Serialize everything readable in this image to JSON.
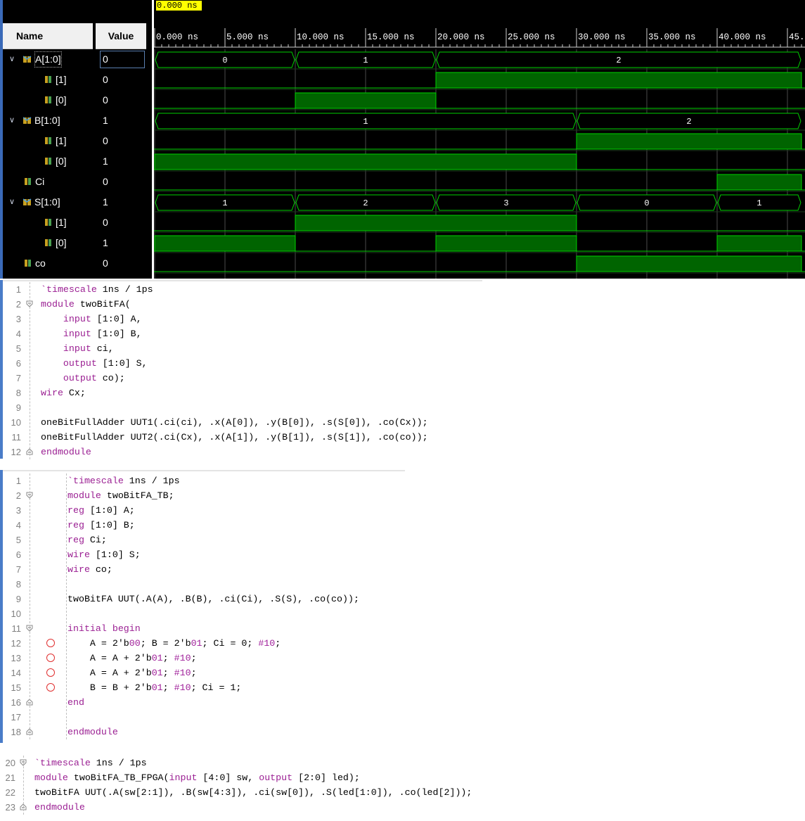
{
  "waveform": {
    "cursor_time": "0.000 ns",
    "columns": {
      "name": "Name",
      "value": "Value"
    },
    "time_ticks": [
      "0.000 ns",
      "5.000 ns",
      "10.000 ns",
      "15.000 ns",
      "20.000 ns",
      "25.000 ns",
      "30.000 ns",
      "35.000 ns",
      "40.000 ns",
      "45."
    ],
    "signals": [
      {
        "name": "A[1:0]",
        "value": "0",
        "kind": "bus",
        "level": 0,
        "expanded": true,
        "segments": [
          {
            "t0": 0,
            "t1": 10,
            "label": "0"
          },
          {
            "t0": 10,
            "t1": 20,
            "label": "1"
          },
          {
            "t0": 20,
            "t1": 46,
            "label": "2"
          }
        ]
      },
      {
        "name": "[1]",
        "value": "0",
        "kind": "bit",
        "level": 1,
        "highs": [
          [
            20,
            46
          ]
        ]
      },
      {
        "name": "[0]",
        "value": "0",
        "kind": "bit",
        "level": 1,
        "highs": [
          [
            10,
            20
          ]
        ]
      },
      {
        "name": "B[1:0]",
        "value": "1",
        "kind": "bus",
        "level": 0,
        "expanded": true,
        "segments": [
          {
            "t0": 0,
            "t1": 30,
            "label": "1"
          },
          {
            "t0": 30,
            "t1": 46,
            "label": "2"
          }
        ]
      },
      {
        "name": "[1]",
        "value": "0",
        "kind": "bit",
        "level": 1,
        "highs": [
          [
            30,
            46
          ]
        ]
      },
      {
        "name": "[0]",
        "value": "1",
        "kind": "bit",
        "level": 1,
        "highs": [
          [
            0,
            30
          ]
        ]
      },
      {
        "name": "Ci",
        "value": "0",
        "kind": "bit",
        "level": 0,
        "highs": [
          [
            40,
            46
          ]
        ]
      },
      {
        "name": "S[1:0]",
        "value": "1",
        "kind": "bus",
        "level": 0,
        "expanded": true,
        "segments": [
          {
            "t0": 0,
            "t1": 10,
            "label": "1"
          },
          {
            "t0": 10,
            "t1": 20,
            "label": "2"
          },
          {
            "t0": 20,
            "t1": 30,
            "label": "3"
          },
          {
            "t0": 30,
            "t1": 40,
            "label": "0"
          },
          {
            "t0": 40,
            "t1": 46,
            "label": "1"
          }
        ]
      },
      {
        "name": "[1]",
        "value": "0",
        "kind": "bit",
        "level": 1,
        "highs": [
          [
            10,
            30
          ]
        ]
      },
      {
        "name": "[0]",
        "value": "1",
        "kind": "bit",
        "level": 1,
        "highs": [
          [
            0,
            10
          ],
          [
            20,
            30
          ],
          [
            40,
            46
          ]
        ]
      },
      {
        "name": "co",
        "value": "0",
        "kind": "bit",
        "level": 0,
        "highs": [
          [
            30,
            46
          ]
        ]
      }
    ]
  },
  "editor1": {
    "lines": [
      {
        "n": "1",
        "t": "`timescale 1ns / 1ps"
      },
      {
        "n": "2",
        "t": "module twoBitFA("
      },
      {
        "n": "3",
        "t": "    input [1:0] A,"
      },
      {
        "n": "4",
        "t": "    input [1:0] B,"
      },
      {
        "n": "5",
        "t": "    input ci,"
      },
      {
        "n": "6",
        "t": "    output [1:0] S,"
      },
      {
        "n": "7",
        "t": "    output co);"
      },
      {
        "n": "8",
        "t": "wire Cx;"
      },
      {
        "n": "9",
        "t": ""
      },
      {
        "n": "10",
        "t": "oneBitFullAdder UUT1(.ci(ci), .x(A[0]), .y(B[0]), .s(S[0]), .co(Cx));"
      },
      {
        "n": "11",
        "t": "oneBitFullAdder UUT2(.ci(Cx), .x(A[1]), .y(B[1]), .s(S[1]), .co(co));"
      },
      {
        "n": "12",
        "t": "endmodule"
      }
    ]
  },
  "editor2": {
    "lines": [
      {
        "n": "1",
        "t": "`timescale 1ns / 1ps"
      },
      {
        "n": "2",
        "t": "module twoBitFA_TB;"
      },
      {
        "n": "3",
        "t": "reg [1:0] A;"
      },
      {
        "n": "4",
        "t": "reg [1:0] B;"
      },
      {
        "n": "5",
        "t": "reg Ci;"
      },
      {
        "n": "6",
        "t": "wire [1:0] S;"
      },
      {
        "n": "7",
        "t": "wire co;"
      },
      {
        "n": "8",
        "t": ""
      },
      {
        "n": "9",
        "t": "twoBitFA UUT(.A(A), .B(B), .ci(Ci), .S(S), .co(co));"
      },
      {
        "n": "10",
        "t": ""
      },
      {
        "n": "11",
        "t": "initial begin"
      },
      {
        "n": "12",
        "t": "    A = 2'b00; B = 2'b01; Ci = 0; #10;"
      },
      {
        "n": "13",
        "t": "    A = A + 2'b01; #10;"
      },
      {
        "n": "14",
        "t": "    A = A + 2'b01; #10;"
      },
      {
        "n": "15",
        "t": "    B = B + 2'b01; #10; Ci = 1;"
      },
      {
        "n": "16",
        "t": "end"
      },
      {
        "n": "17",
        "t": ""
      },
      {
        "n": "18",
        "t": "endmodule"
      }
    ]
  },
  "editor3": {
    "lines": [
      {
        "n": "20",
        "t": "`timescale 1ns / 1ps"
      },
      {
        "n": "21",
        "t": "module twoBitFA_TB_FPGA(input [4:0] sw, output [2:0] led);"
      },
      {
        "n": "22",
        "t": "twoBitFA UUT(.A(sw[2:1]), .B(sw[4:3]), .ci(sw[0]), .S(led[1:0]), .co(led[2]));"
      },
      {
        "n": "23",
        "t": "endmodule"
      }
    ]
  },
  "colors": {
    "wave_high_fill": "#006400",
    "wave_line": "#00d000",
    "bus_text": "#ffffff",
    "keyword": "#9b2093",
    "breakpoint": "#e03030"
  }
}
